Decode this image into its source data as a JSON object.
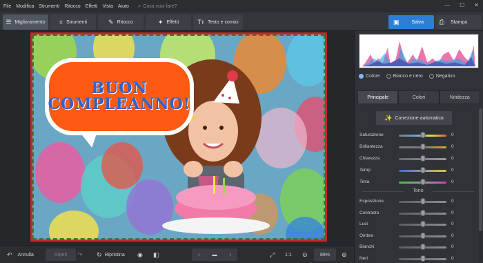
{
  "menu": [
    "File",
    "Modifica",
    "Strumenti",
    "Ritocco",
    "Effetti",
    "Vista",
    "Aiuto"
  ],
  "search": {
    "placeholder": "Cosa vuoi fare?",
    "icon": "search-icon"
  },
  "window_controls": [
    "—",
    "☐",
    "✕"
  ],
  "tabs": [
    {
      "label": "Miglioramento",
      "icon": "sliders-icon",
      "active": true
    },
    {
      "label": "Strumenti",
      "icon": "crop-icon",
      "active": false
    },
    {
      "label": "Ritocco",
      "icon": "brush-icon",
      "active": false
    },
    {
      "label": "Effetti",
      "icon": "wand-icon",
      "active": false
    },
    {
      "label": "Testo e cornici",
      "icon": "text-icon",
      "active": false
    }
  ],
  "actions": {
    "save": "Salva",
    "print": "Stampa"
  },
  "canvas": {
    "greeting_line1": "BUON",
    "greeting_line2": "COMPLEANNO!"
  },
  "bottom": {
    "undo": "Annulla",
    "redo": "Ripeti",
    "reset": "Ripristina",
    "actual_size": "1:1",
    "zoom": "89%"
  },
  "panel": {
    "modes": [
      {
        "label": "Colore",
        "selected": true
      },
      {
        "label": "Bianco e nero",
        "selected": false
      },
      {
        "label": "Negativo",
        "selected": false
      }
    ],
    "subtabs": [
      "Principale",
      "Colori",
      "Nitidezza"
    ],
    "auto_correct": "Correzione automatica",
    "section_tono": "Tono",
    "sliders_color": [
      {
        "label": "Saturazione",
        "value": "0",
        "level": 0.5
      },
      {
        "label": "Brillantezza",
        "value": "0",
        "level": 0.5
      },
      {
        "label": "Chiarezza",
        "value": "0",
        "level": 0.5
      },
      {
        "label": "Temp",
        "value": "0",
        "level": 0.5
      },
      {
        "label": "Tinta",
        "value": "0",
        "level": 0.5
      }
    ],
    "sliders_tone": [
      {
        "label": "Esposizione",
        "value": "0",
        "level": 0.5
      },
      {
        "label": "Contrasto",
        "value": "0",
        "level": 0.5
      },
      {
        "label": "Luci",
        "value": "0",
        "level": 0.5
      },
      {
        "label": "Ombre",
        "value": "0",
        "level": 0.5
      },
      {
        "label": "Bianchi",
        "value": "0",
        "level": 0.5
      },
      {
        "label": "Neri",
        "value": "0",
        "level": 0.5
      }
    ]
  },
  "colors": {
    "accent": "#2e7ed6",
    "bubble": "#ff5a14",
    "bubble_text": "#2f64c9",
    "frame_red": "#c62828",
    "frame_green": "#2e7d32"
  }
}
